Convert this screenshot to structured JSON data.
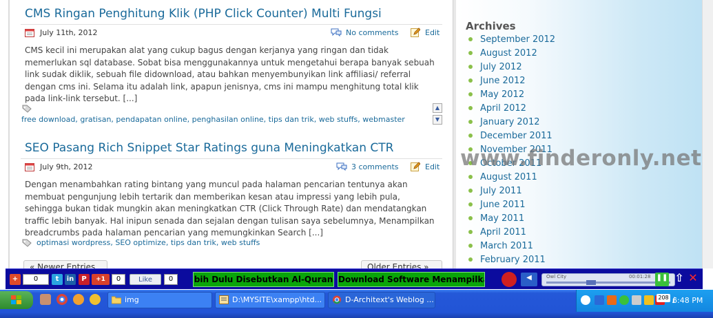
{
  "posts": [
    {
      "title": "CMS Ringan Penghitung Klik (PHP Click Counter) Multi Fungsi",
      "date": "July 11th, 2012",
      "comments": "No comments",
      "edit": "Edit",
      "excerpt": "CMS kecil ini merupakan alat yang cukup bagus dengan kerjanya yang ringan dan tidak memerlukan sql database. Sobat bisa menggunakannya untuk mengetahui berapa banyak sebuah link sudak diklik, sebuah file didownload, atau bahkan menyembunyikan link affiliasi/ referral dengan cms ini. Selama itu adalah link, apapun jenisnya, cms ini mampu menghitung total klik pada link-link tersebut. [...]",
      "tags": "free download, gratisan, pendapatan online, penghasilan online, tips dan trik, web stuffs, webmaster"
    },
    {
      "title": "SEO Pasang Rich Snippet Star Ratings guna Meningkatkan CTR",
      "date": "July 9th, 2012",
      "comments": "3 comments",
      "edit": "Edit",
      "excerpt": "Dengan menambahkan rating bintang yang muncul pada halaman pencarian tentunya akan membuat pengunjung lebih tertarik dan memberikan kesan atau impressi yang lebih pula, sehingga bukan tidak mungkin akan meningkatkan CTR (Click Through Rate) dan mendatangkan traffic lebih banyak. Hal inipun senada dan sejalan dengan tulisan saya sebelumnya, Menampilkan breadcrumbs pada halaman pencarian yang memungkinkan Search [...]",
      "tags": "optimasi wordpress, SEO optimize, tips dan trik, web stuffs"
    }
  ],
  "nav": {
    "newer": "« Newer Entries",
    "older": "Older Entries »"
  },
  "sidebar": {
    "title": "Archives",
    "items": [
      "September 2012",
      "August 2012",
      "July 2012",
      "June 2012",
      "May 2012",
      "April 2012",
      "January 2012",
      "December 2011",
      "November 2011",
      "October 2011",
      "August 2011",
      "July 2011",
      "June 2011",
      "May 2011",
      "April 2011",
      "March 2011",
      "February 2011"
    ]
  },
  "watermark": "www.finderonly.net",
  "social": {
    "counts": [
      "0",
      "0"
    ],
    "gplus": "+1",
    "like": "Like",
    "like_count": "0",
    "ticker1": "bih Dulu Disebutkan Al-Quran",
    "ticker2": "Download Software Menampilkan A",
    "player_title": "Owl City",
    "player_time": "00:01:28"
  },
  "taskbar": {
    "tasks": [
      "img",
      "D:\\MYSITE\\xampp\\htd...",
      "D-Architext's Weblog ..."
    ],
    "clock": "6:48 PM",
    "tray_badge": "208"
  }
}
